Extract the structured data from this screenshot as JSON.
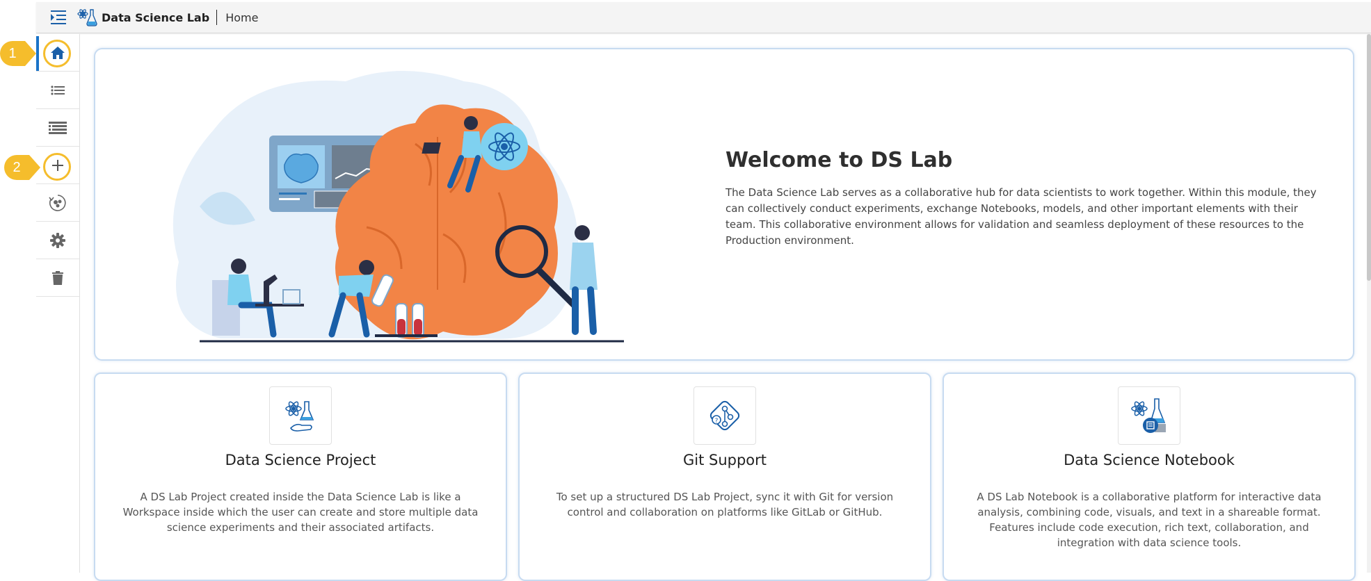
{
  "header": {
    "app_title": "Data Science Lab",
    "breadcrumb": "Home"
  },
  "sidebar": {
    "items": [
      {
        "icon": "home-icon",
        "active": true
      },
      {
        "icon": "list-icon"
      },
      {
        "icon": "list-view-icon"
      },
      {
        "icon": "add-icon"
      },
      {
        "icon": "model-hub-icon"
      },
      {
        "icon": "gear-icon"
      },
      {
        "icon": "trash-icon"
      }
    ],
    "callouts": [
      "1",
      "2"
    ]
  },
  "hero": {
    "title": "Welcome to DS Lab",
    "description": "The Data Science Lab serves as a collaborative hub for data scientists to work together. Within this module, they can collectively conduct experiments, exchange Notebooks, models, and other important elements with their team. This collaborative environment allows for validation and seamless deployment of these resources to the Production environment."
  },
  "cards": [
    {
      "title": "Data Science Project",
      "description": "A DS Lab Project created inside the Data Science Lab is like a Workspace inside which the user can create and store multiple data science experiments and their associated artifacts.",
      "icon": "project-icon"
    },
    {
      "title": "Git Support",
      "description": "To set up a structured DS Lab Project, sync it with Git for version control and collaboration on platforms like GitLab or GitHub.",
      "icon": "git-icon"
    },
    {
      "title": "Data Science Notebook",
      "description": "A DS Lab Notebook is a collaborative platform for interactive data analysis, combining code, visuals, and text in a shareable format. Features include code execution, rich text, collaboration, and integration with data science tools.",
      "icon": "notebook-icon"
    }
  ],
  "colors": {
    "accent": "#1a73c8",
    "callout": "#f5bd2c",
    "card_border": "#c7dbf1"
  }
}
